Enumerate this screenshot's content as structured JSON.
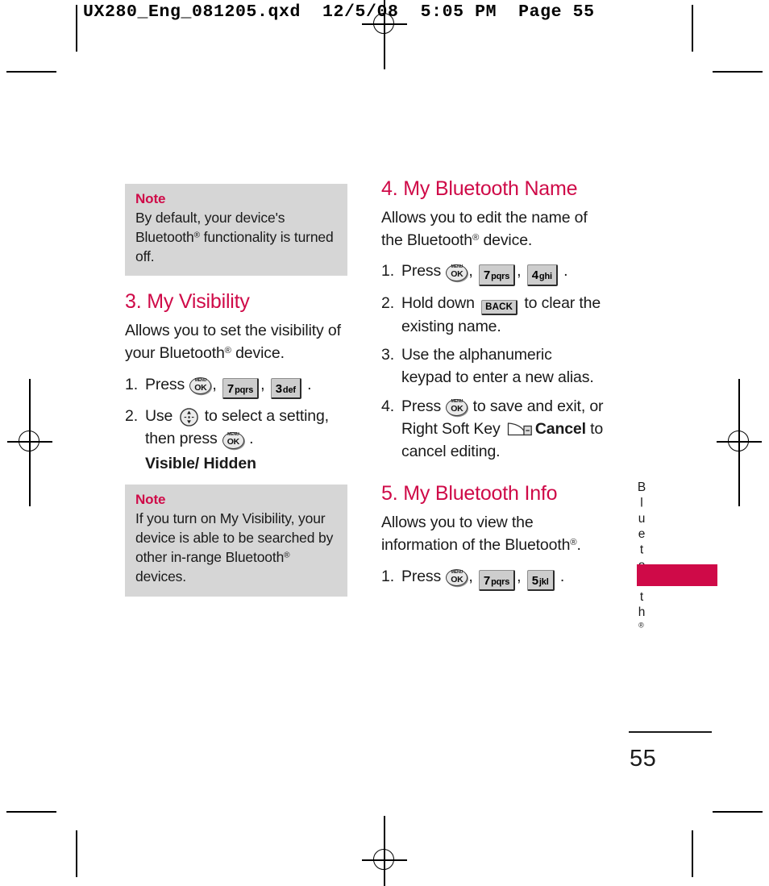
{
  "document": {
    "slug": "UX280_Eng_081205.qxd  12/5/08  5:05 PM  Page 55",
    "page_number": "55",
    "side_tab_label": "Bluetooth",
    "side_tab_superscript": "®",
    "accent_color": "#cf0a48",
    "note_background_color": "#d6d6d6"
  },
  "left_column": {
    "note_top": {
      "label": "Note",
      "text_before": "By default, your device's Bluetooth",
      "superscript": "®",
      "text_after": " functionality is turned off."
    },
    "section": {
      "title": "3. My Visibility",
      "intro_before": "Allows you to set the visibility of your Bluetooth",
      "intro_superscript": "®",
      "intro_after": " device.",
      "steps": [
        {
          "num": "1.",
          "parts": [
            {
              "type": "text",
              "value": "Press "
            },
            {
              "type": "key-ok",
              "top": "MENU",
              "main": "OK"
            },
            {
              "type": "text",
              "value": ", "
            },
            {
              "type": "key-num",
              "digit": "7",
              "letters": "pqrs"
            },
            {
              "type": "text",
              "value": ", "
            },
            {
              "type": "key-num",
              "digit": "3",
              "letters": "def"
            },
            {
              "type": "text",
              "value": " ."
            }
          ]
        },
        {
          "num": "2.",
          "parts": [
            {
              "type": "text",
              "value": "Use "
            },
            {
              "type": "key-nav"
            },
            {
              "type": "text",
              "value": " to select a setting, then press "
            },
            {
              "type": "key-ok",
              "top": "MENU",
              "main": "OK"
            },
            {
              "type": "text",
              "value": " ."
            }
          ]
        }
      ],
      "sub_option": "Visible/ Hidden"
    },
    "note_bottom": {
      "label": "Note",
      "text_before": "If you turn on My Visibility, your device is able to be searched by other in-range Bluetooth",
      "superscript": "®",
      "text_after": " devices."
    }
  },
  "right_column": {
    "section_4": {
      "title": "4. My Bluetooth Name",
      "intro_before": "Allows you to edit the name of the Bluetooth",
      "intro_superscript": "®",
      "intro_after": " device.",
      "steps": [
        {
          "num": "1.",
          "text_press": "Press ",
          "key_ok_top": "MENU",
          "key_ok_main": "OK",
          "sep1": ", ",
          "key1_digit": "7",
          "key1_letters": "pqrs",
          "sep2": ", ",
          "key2_digit": "4",
          "key2_letters": "ghi",
          "tail": " ."
        },
        {
          "num": "2.",
          "text_before": "Hold down ",
          "key_back": "BACK",
          "text_after": " to clear the existing name."
        },
        {
          "num": "3.",
          "text": "Use the alphanumeric keypad to enter a new alias."
        },
        {
          "num": "4.",
          "text_press": "Press ",
          "key_ok_top": "MENU",
          "key_ok_main": "OK",
          "text_mid": " to save and exit, or Right Soft Key ",
          "bold_label": "Cancel",
          "text_end": " to cancel editing."
        }
      ]
    },
    "section_5": {
      "title": "5. My Bluetooth Info",
      "intro_before": "Allows you to view the information of the Bluetooth",
      "intro_superscript": "®",
      "intro_after": ".",
      "steps": [
        {
          "num": "1.",
          "text_press": "Press ",
          "key_ok_top": "MENU",
          "key_ok_main": "OK",
          "sep1": ", ",
          "key1_digit": "7",
          "key1_letters": "pqrs",
          "sep2": ", ",
          "key2_digit": "5",
          "key2_letters": "jkl",
          "tail": " ."
        }
      ]
    }
  }
}
